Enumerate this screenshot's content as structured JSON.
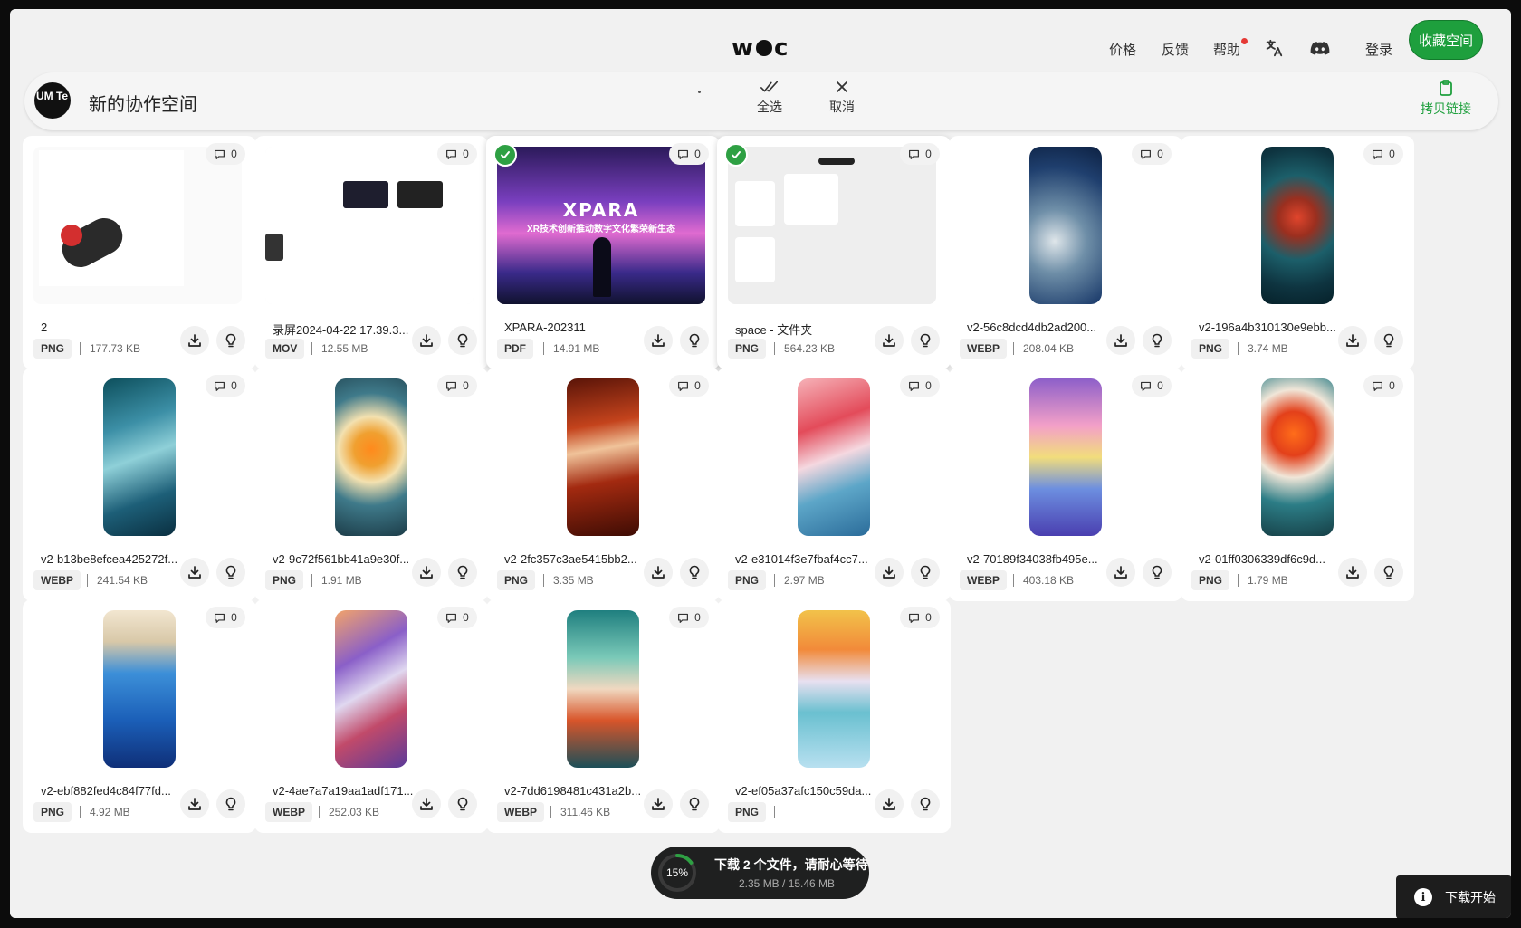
{
  "nav": {
    "logo_left": "w",
    "logo_right": "c",
    "links": {
      "price": "价格",
      "feedback": "反馈",
      "help": "帮助"
    },
    "login": "登录",
    "favorite_button": "收藏空间",
    "icons": [
      "translate-icon",
      "discord-icon"
    ]
  },
  "workspace": {
    "avatar_text": "UM Te",
    "title": "新的协作空间",
    "select_all": "全选",
    "cancel": "取消",
    "copy_link": "拷贝链接"
  },
  "files": [
    {
      "name": "2",
      "type": "PNG",
      "size": "177.73 KB",
      "comments": "0",
      "selected": false
    },
    {
      "name": "录屏2024-04-22 17.39.3...",
      "type": "MOV",
      "size": "12.55 MB",
      "comments": "0",
      "selected": false
    },
    {
      "name": "XPARA-202311",
      "type": "PDF",
      "size": "14.91 MB",
      "comments": "0",
      "selected": true,
      "thumb_title": "XPARA",
      "thumb_sub": "XR技术创新推动数字文化繁荣新生态"
    },
    {
      "name": "space - 文件夹",
      "type": "PNG",
      "size": "564.23 KB",
      "comments": "0",
      "selected": true
    },
    {
      "name": "v2-56c8dcd4db2ad200...",
      "type": "WEBP",
      "size": "208.04 KB",
      "comments": "0",
      "selected": false
    },
    {
      "name": "v2-196a4b310130e9ebb...",
      "type": "PNG",
      "size": "3.74 MB",
      "comments": "0",
      "selected": false
    },
    {
      "name": "v2-b13be8efcea425272f...",
      "type": "WEBP",
      "size": "241.54 KB",
      "comments": "0",
      "selected": false
    },
    {
      "name": "v2-9c72f561bb41a9e30f...",
      "type": "PNG",
      "size": "1.91 MB",
      "comments": "0",
      "selected": false
    },
    {
      "name": "v2-2fc357c3ae5415bb2...",
      "type": "PNG",
      "size": "3.35 MB",
      "comments": "0",
      "selected": false
    },
    {
      "name": "v2-e31014f3e7fbaf4cc7...",
      "type": "PNG",
      "size": "2.97 MB",
      "comments": "0",
      "selected": false
    },
    {
      "name": "v2-70189f34038fb495e...",
      "type": "WEBP",
      "size": "403.18 KB",
      "comments": "0",
      "selected": false
    },
    {
      "name": "v2-01ff0306339df6c9d...",
      "type": "PNG",
      "size": "1.79 MB",
      "comments": "0",
      "selected": false
    },
    {
      "name": "v2-ebf882fed4c84f77fd...",
      "type": "PNG",
      "size": "4.92 MB",
      "comments": "0",
      "selected": false
    },
    {
      "name": "v2-4ae7a7a19aa1adf171...",
      "type": "WEBP",
      "size": "252.03 KB",
      "comments": "0",
      "selected": false
    },
    {
      "name": "v2-7dd6198481c431a2b...",
      "type": "WEBP",
      "size": "311.46 KB",
      "comments": "0",
      "selected": false
    },
    {
      "name": "v2-ef05a37afc150c59da...",
      "type": "PNG",
      "size": "",
      "comments": "0",
      "selected": false
    }
  ],
  "download": {
    "percent_label": "15%",
    "progress": 0.15,
    "title": "下载 2 个文件，请耐心等待",
    "detail": "2.35 MB / 15.46 MB"
  },
  "toast": {
    "text": "下载开始"
  },
  "colors": {
    "accent": "#1e9f3d",
    "selected_check": "#2ea043"
  }
}
